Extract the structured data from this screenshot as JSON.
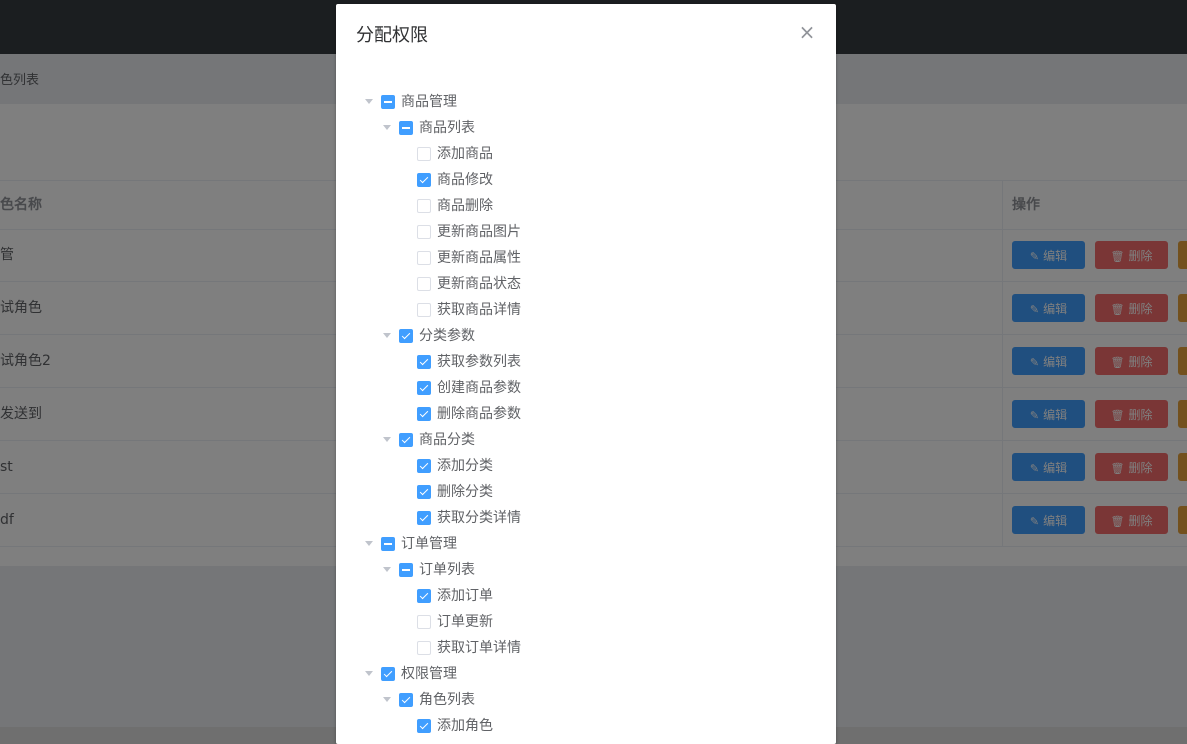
{
  "breadcrumb": {
    "tail": "色列表"
  },
  "table": {
    "col_name": "色名称",
    "col_ops": "操作",
    "rows": [
      {
        "name": "管"
      },
      {
        "name": "试角色"
      },
      {
        "name": "试角色2"
      },
      {
        "name": "发送到"
      },
      {
        "name": "st"
      },
      {
        "name": "df"
      }
    ],
    "edit_label": "编辑",
    "delete_label": "删除"
  },
  "dialog": {
    "title": "分配权限",
    "close_glyph": "×"
  },
  "tree": [
    {
      "label": "商品管理",
      "level": 0,
      "state": "half",
      "expanded": true
    },
    {
      "label": "商品列表",
      "level": 1,
      "state": "half",
      "expanded": true
    },
    {
      "label": "添加商品",
      "level": 2,
      "state": "unchecked"
    },
    {
      "label": "商品修改",
      "level": 2,
      "state": "checked"
    },
    {
      "label": "商品删除",
      "level": 2,
      "state": "unchecked"
    },
    {
      "label": "更新商品图片",
      "level": 2,
      "state": "unchecked"
    },
    {
      "label": "更新商品属性",
      "level": 2,
      "state": "unchecked"
    },
    {
      "label": "更新商品状态",
      "level": 2,
      "state": "unchecked"
    },
    {
      "label": "获取商品详情",
      "level": 2,
      "state": "unchecked"
    },
    {
      "label": "分类参数",
      "level": 1,
      "state": "checked",
      "expanded": true
    },
    {
      "label": "获取参数列表",
      "level": 2,
      "state": "checked"
    },
    {
      "label": "创建商品参数",
      "level": 2,
      "state": "checked"
    },
    {
      "label": "删除商品参数",
      "level": 2,
      "state": "checked"
    },
    {
      "label": "商品分类",
      "level": 1,
      "state": "checked",
      "expanded": true
    },
    {
      "label": "添加分类",
      "level": 2,
      "state": "checked"
    },
    {
      "label": "删除分类",
      "level": 2,
      "state": "checked"
    },
    {
      "label": "获取分类详情",
      "level": 2,
      "state": "checked"
    },
    {
      "label": "订单管理",
      "level": 0,
      "state": "half",
      "expanded": true
    },
    {
      "label": "订单列表",
      "level": 1,
      "state": "half",
      "expanded": true
    },
    {
      "label": "添加订单",
      "level": 2,
      "state": "checked"
    },
    {
      "label": "订单更新",
      "level": 2,
      "state": "unchecked"
    },
    {
      "label": "获取订单详情",
      "level": 2,
      "state": "unchecked"
    },
    {
      "label": "权限管理",
      "level": 0,
      "state": "checked",
      "expanded": true
    },
    {
      "label": "角色列表",
      "level": 1,
      "state": "checked",
      "expanded": true
    },
    {
      "label": "添加角色",
      "level": 2,
      "state": "checked"
    }
  ],
  "colors": {
    "primary": "#409eff",
    "danger": "#f56c6c",
    "warning": "#e6a23c",
    "topbar": "#373d41"
  },
  "icons": {
    "edit": "edit-icon",
    "delete": "delete-icon",
    "caret": "caret-down-icon",
    "close": "close-icon"
  }
}
